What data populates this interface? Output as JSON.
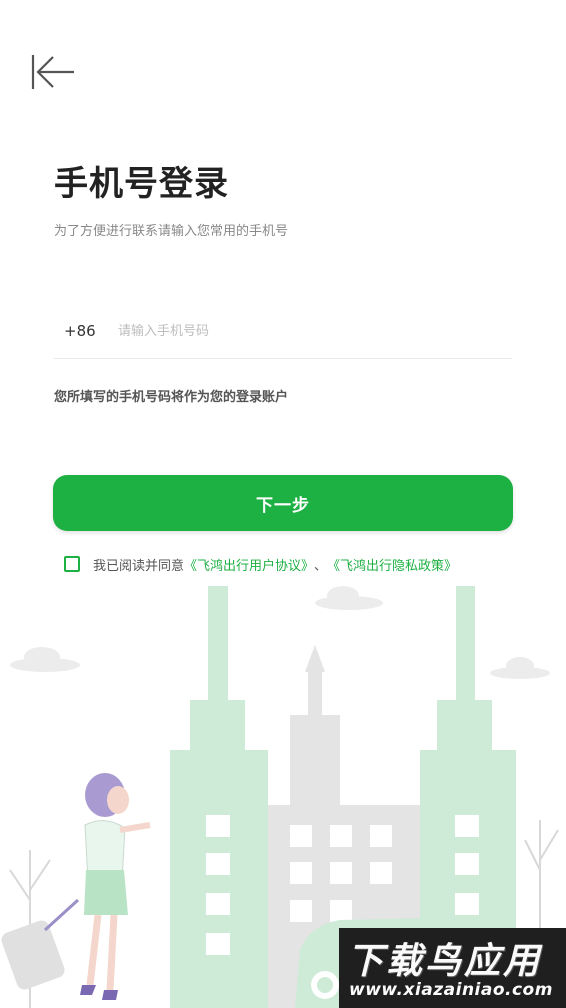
{
  "header": {
    "back_icon": "back-to-start-arrow-icon"
  },
  "title": "手机号登录",
  "subtitle": "为了方便进行联系请输入您常用的手机号",
  "phone": {
    "country_code": "+86",
    "placeholder": "请输入手机号码",
    "value": ""
  },
  "hint": "您所填写的手机号码将作为您的登录账户",
  "next_button": "下一步",
  "agreement": {
    "checked": false,
    "prefix": "我已阅读并同意",
    "user_agreement": "《飞鸿出行用户协议》",
    "separator": "、",
    "privacy_policy": "《飞鸿出行隐私政策》"
  },
  "watermark": {
    "text_cn": "下载鸟应用",
    "text_url": "www.xiazainiao.com"
  },
  "colors": {
    "accent": "#1db043",
    "building_green": "#cdebd7",
    "building_gray": "#e4e4e4"
  }
}
